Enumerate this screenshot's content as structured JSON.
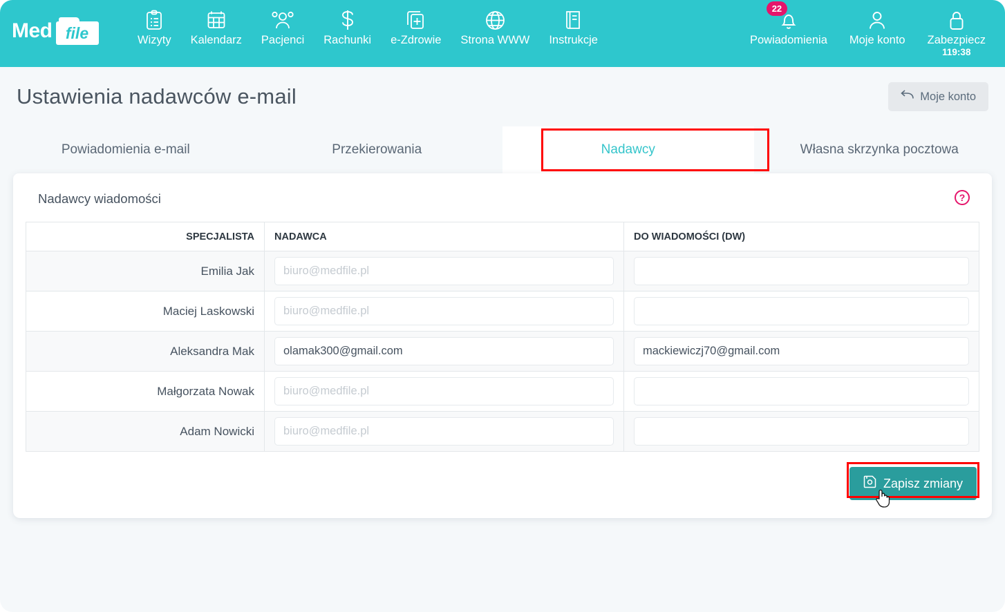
{
  "navbar": {
    "logo": {
      "med": "Med",
      "file": "file"
    },
    "items": [
      {
        "label": "Wizyty",
        "icon": "clipboard-icon"
      },
      {
        "label": "Kalendarz",
        "icon": "calendar-icon"
      },
      {
        "label": "Pacjenci",
        "icon": "users-icon"
      },
      {
        "label": "Rachunki",
        "icon": "dollar-icon"
      },
      {
        "label": "e-Zdrowie",
        "icon": "medical-card-icon"
      },
      {
        "label": "Strona WWW",
        "icon": "globe-icon"
      },
      {
        "label": "Instrukcje",
        "icon": "book-icon"
      }
    ],
    "right_items": [
      {
        "label": "Powiadomienia",
        "icon": "bell-icon",
        "badge": "22"
      },
      {
        "label": "Moje konto",
        "icon": "user-icon"
      },
      {
        "label": "Zabezpiecz",
        "icon": "lock-icon",
        "timer": "119:38"
      }
    ]
  },
  "header": {
    "title": "Ustawienia nadawców e-mail",
    "back_button": "Moje konto",
    "back_icon": "arrow-left-icon"
  },
  "tabs": [
    {
      "label": "Powiadomienia e-mail",
      "active": false
    },
    {
      "label": "Przekierowania",
      "active": false
    },
    {
      "label": "Nadawcy",
      "active": true
    },
    {
      "label": "Własna skrzynka pocztowa",
      "active": false
    }
  ],
  "card": {
    "title": "Nadawcy wiadomości",
    "help_icon": "question-mark-icon",
    "columns": [
      "SPECJALISTA",
      "NADAWCA",
      "DO WIADOMOŚCI (DW)"
    ],
    "placeholder": "biuro@medfile.pl",
    "rows": [
      {
        "specialist": "Emilia Jak",
        "sender": "",
        "cc": ""
      },
      {
        "specialist": "Maciej Laskowski",
        "sender": "",
        "cc": ""
      },
      {
        "specialist": "Aleksandra Mak",
        "sender": "olamak300@gmail.com",
        "cc": "mackiewiczj70@gmail.com"
      },
      {
        "specialist": "Małgorzata Nowak",
        "sender": "",
        "cc": ""
      },
      {
        "specialist": "Adam Nowicki",
        "sender": "",
        "cc": ""
      }
    ],
    "save_button": "Zapisz zmiany",
    "save_icon": "floppy-disk-icon"
  },
  "colors": {
    "navbar_teal": "#2ec7cd",
    "accent_teal": "#35c5cb",
    "save_teal": "#2a9d9d",
    "badge_pink": "#e5156b",
    "highlight_red": "#ff0000",
    "page_bg": "#f5f8fa"
  }
}
